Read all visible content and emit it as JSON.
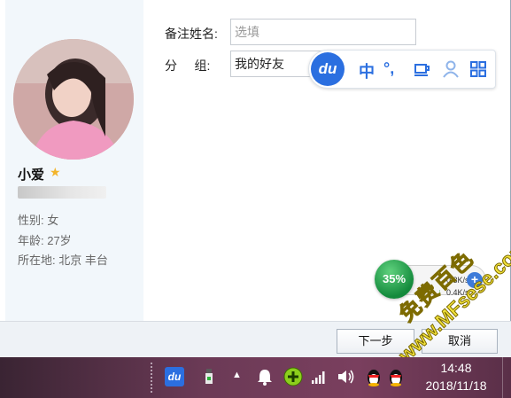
{
  "profile": {
    "name": "小爱",
    "gender": "性别: 女",
    "age": "年龄: 27岁",
    "location": "所在地: 北京  丰台"
  },
  "form": {
    "remark_label": "备注姓名:",
    "remark_placeholder": "选填",
    "group_label": "分     组:",
    "group_value": "我的好友"
  },
  "buttons": {
    "next": "下一步",
    "cancel": "取消"
  },
  "ime_toolbar": {
    "logo": "du",
    "mode": "中",
    "punct": "°,",
    "colors": {
      "accent": "#2b6fe0"
    }
  },
  "net_widget": {
    "percent": "35%",
    "up": "0.3K/s",
    "down": "0.4K/s"
  },
  "watermark": {
    "line1": "免费百色",
    "line2": "www.MFsese.com"
  },
  "taskbar": {
    "time": "14:48",
    "date": "2018/11/18"
  }
}
